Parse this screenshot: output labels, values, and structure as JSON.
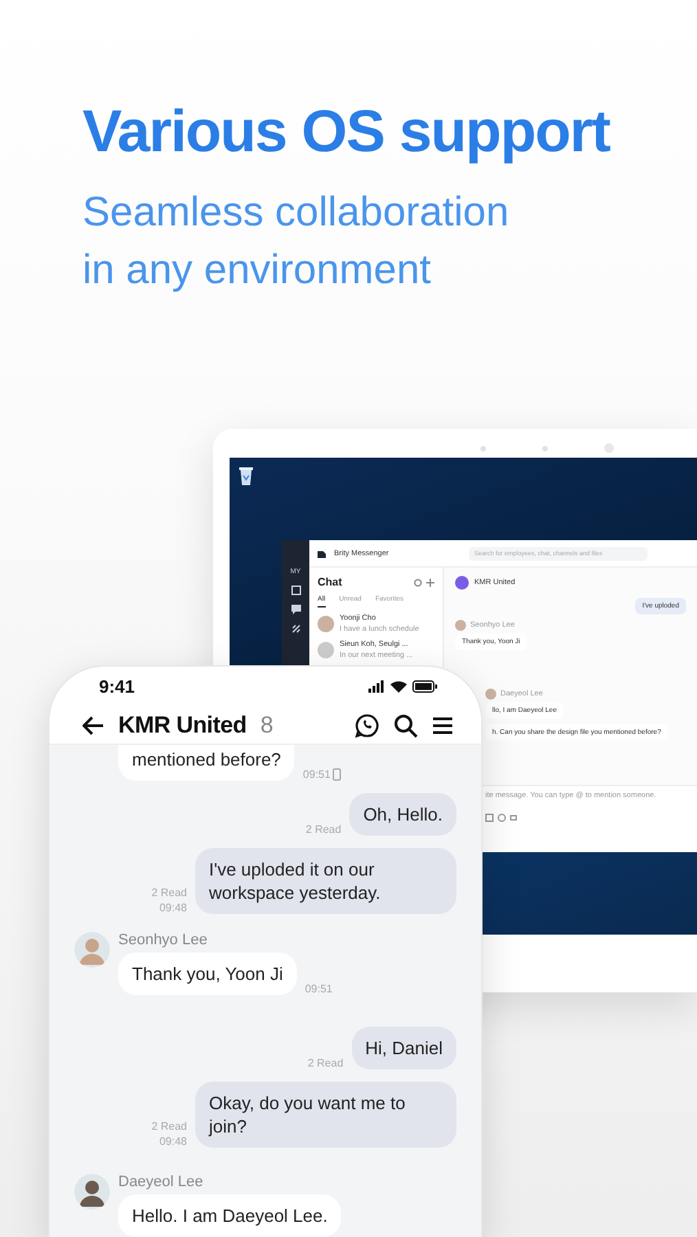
{
  "headline": {
    "title": "Various OS support",
    "subtitle_lines": [
      "Seamless collaboration",
      "in any environment"
    ]
  },
  "laptop": {
    "app_name": "Brity Messenger",
    "search_placeholder": "Search for employees, chat, channels and files",
    "rail_label": "MY",
    "chat_list": {
      "title": "Chat",
      "tabs": [
        {
          "label": "All",
          "selected": true
        },
        {
          "label": "Unread",
          "selected": false
        },
        {
          "label": "Favorites",
          "selected": false
        }
      ],
      "items": [
        {
          "name": "Yoonji Cho",
          "preview": "I have a lunch schedule"
        },
        {
          "name": "Sieun Koh, Seulgi ...",
          "preview": "In our next meeting ..."
        }
      ]
    },
    "chat_title": "KMR United",
    "messages": [
      {
        "kind": "sent",
        "text": "I've uploded"
      },
      {
        "kind": "received",
        "sender": "Seonhyo Lee",
        "text": "Thank you, Yoon Ji"
      },
      {
        "kind": "received",
        "sender": "Daeyeol Lee",
        "text": "llo, I am Daeyeol Lee"
      },
      {
        "kind": "received",
        "text": "h. Can you share the design file you mentioned before?"
      }
    ],
    "composer_placeholder": "ite message. You can type @ to mention someone."
  },
  "phone": {
    "time": "9:41",
    "chat_title": "KMR United",
    "member_count": "8",
    "messages": [
      {
        "kind": "received",
        "text": "mentioned before?",
        "time": "09:51"
      },
      {
        "kind": "sent",
        "text": "Oh, Hello.",
        "read": "2 Read"
      },
      {
        "kind": "sent",
        "text": "I've uploded it on our workspace yesterday.",
        "read": "2 Read",
        "time": "09:48"
      },
      {
        "kind": "received",
        "sender": "Seonhyo Lee",
        "text": "Thank you, Yoon Ji",
        "time": "09:51"
      },
      {
        "kind": "sent",
        "text": "Hi, Daniel",
        "read": "2 Read"
      },
      {
        "kind": "sent",
        "text": "Okay, do you want me to join?",
        "read": "2 Read",
        "time": "09:48"
      },
      {
        "kind": "received",
        "sender": "Daeyeol Lee",
        "text": "Hello. I am Daeyeol Lee."
      }
    ]
  }
}
